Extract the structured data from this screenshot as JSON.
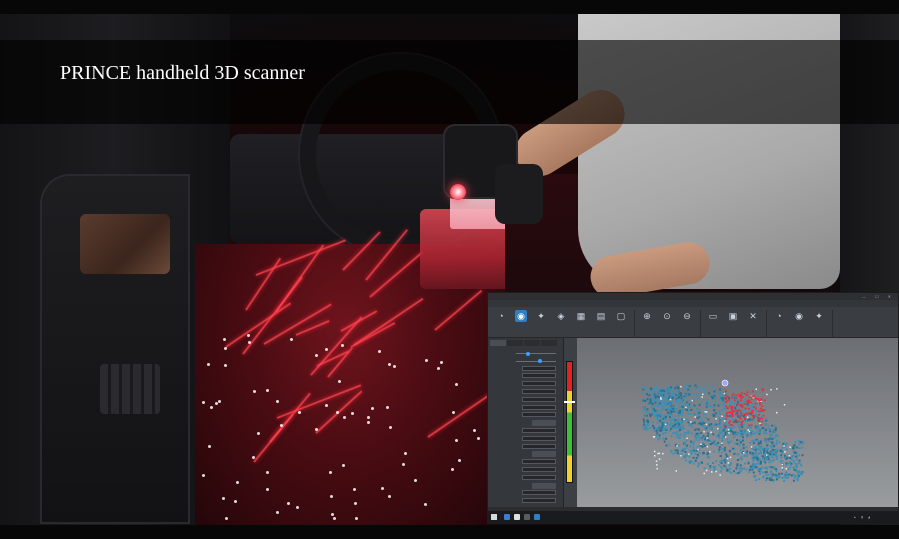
{
  "video": {
    "caption": "PRINCE handheld 3D scanner"
  },
  "software": {
    "title": "",
    "menu": [
      "",
      "",
      "",
      "",
      "",
      ""
    ],
    "toolbar_groups": [
      {
        "label": "",
        "tools": [
          "",
          "",
          "",
          "",
          "",
          "",
          ""
        ]
      },
      {
        "label": "",
        "tools": [
          "",
          "",
          ""
        ]
      },
      {
        "label": "",
        "tools": [
          "",
          "",
          ""
        ]
      },
      {
        "label": "",
        "tools": [
          "",
          "",
          ""
        ]
      }
    ],
    "side_tabs": [
      "",
      "",
      "",
      ""
    ],
    "side_rows": [
      "",
      "",
      "",
      "",
      "",
      "",
      "",
      "",
      "",
      "",
      "",
      "",
      "",
      "",
      "",
      "",
      "",
      "",
      "",
      ""
    ],
    "status_text": "",
    "clock": {
      "time": "",
      "date": ""
    }
  },
  "colors": {
    "accent": "#2f7fc6",
    "point_cloud": "#3f8fb5",
    "point_cloud_dark": "#2c6f8f",
    "point_cloud_highlight": "#e03040",
    "laser": "#ff4650",
    "gauge_red": "#e02424",
    "gauge_yellow": "#f0d32a",
    "gauge_green": "#3cc13c"
  },
  "icons": {
    "toolbar": [
      "scan-icon",
      "mode-icon",
      "target-icon",
      "marker-icon",
      "grid-icon",
      "select-icon",
      "frame-icon",
      "zoom-in-icon",
      "zoom-fit-icon",
      "zoom-out-icon",
      "lasso-icon",
      "box-icon",
      "delete-icon"
    ]
  },
  "scan_distance_gauge": {
    "level": 0.33
  }
}
